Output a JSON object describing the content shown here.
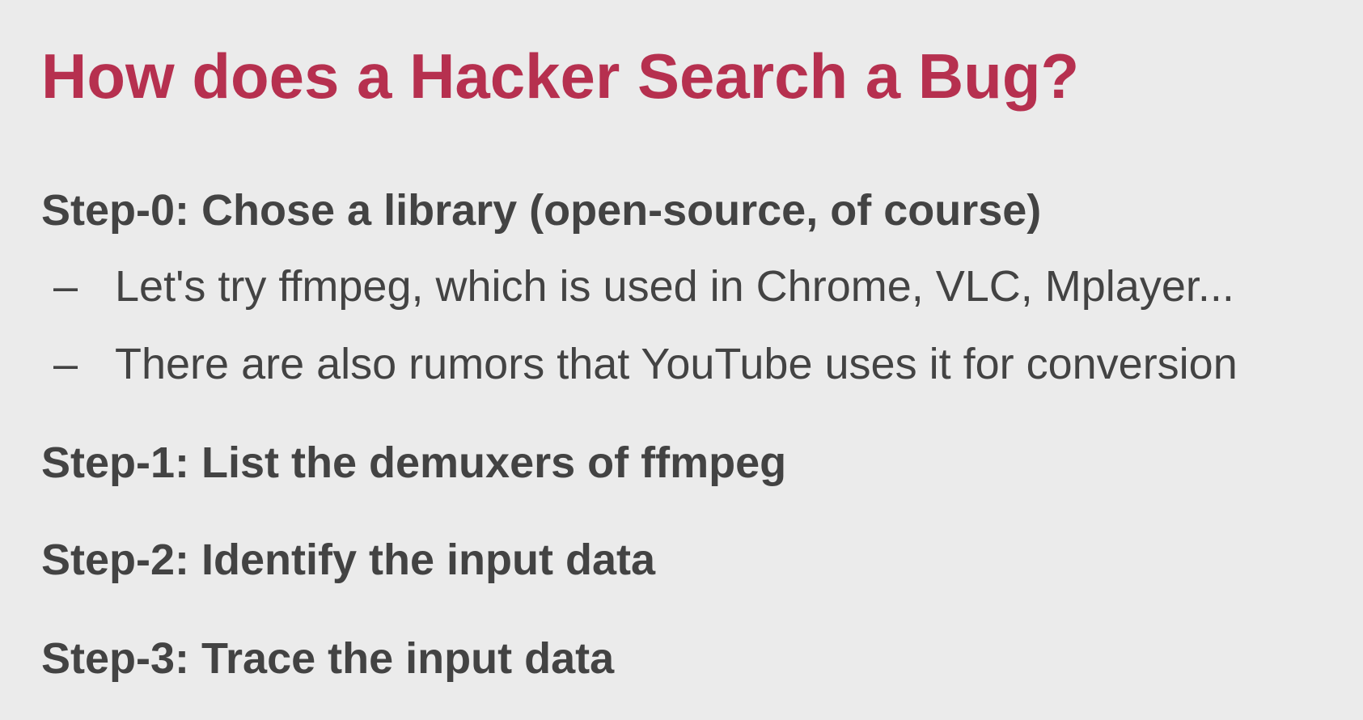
{
  "slide": {
    "title": "How does a Hacker Search a Bug?",
    "accent_color": "#b6304f",
    "text_color": "#434343",
    "background_color": "#ebebeb",
    "items": [
      {
        "text": "Step-0: Chose a library (open-source, of course)",
        "subitems": [
          {
            "bullet": "–",
            "text": "Let's try ffmpeg, which is used in Chrome, VLC, Mplayer..."
          },
          {
            "bullet": "–",
            "text": "There are also rumors that YouTube uses it for conversion"
          }
        ]
      },
      {
        "text": "Step-1: List the demuxers of ffmpeg"
      },
      {
        "text": "Step-2: Identify the input data"
      },
      {
        "text": "Step-3: Trace the input data"
      }
    ]
  }
}
